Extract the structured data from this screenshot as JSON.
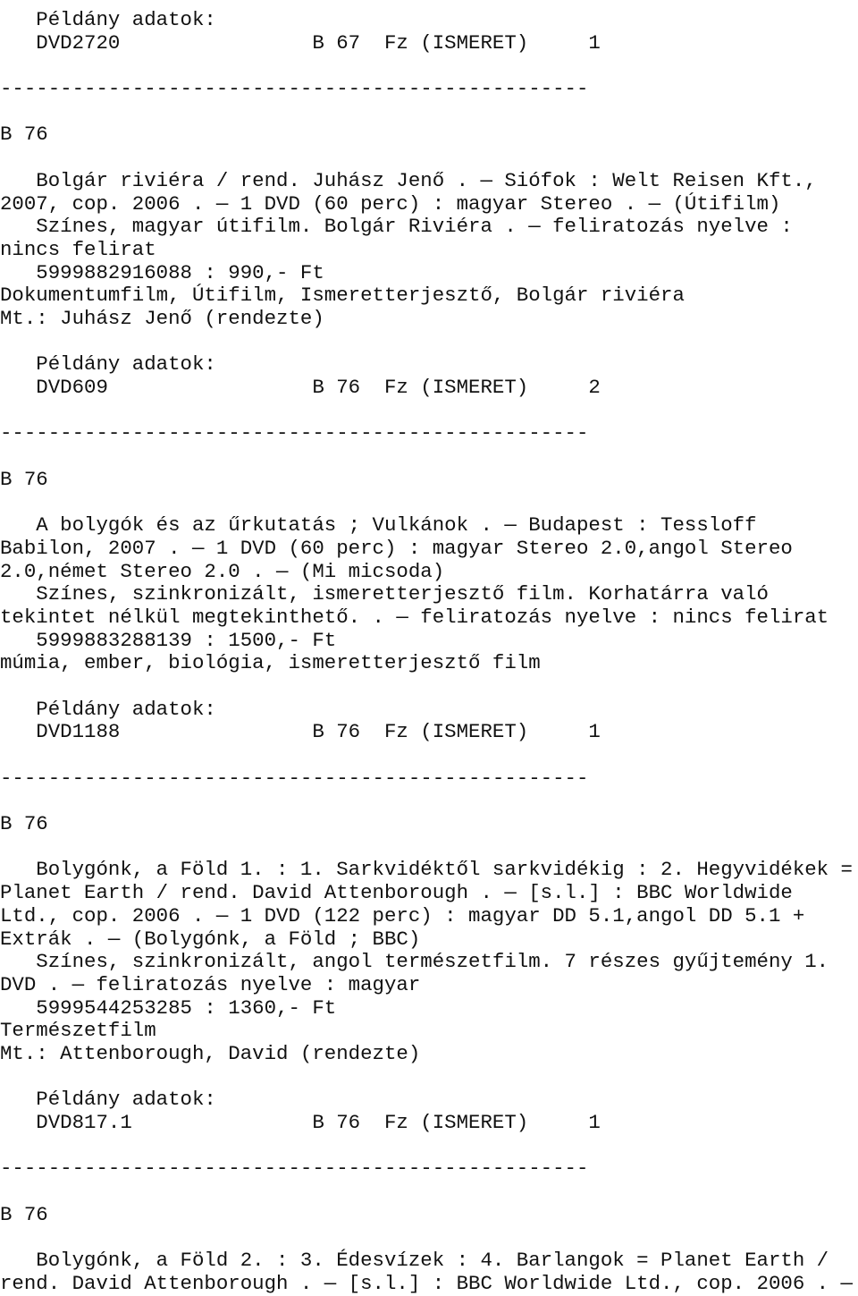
{
  "records": [
    {
      "copy_header": "   Példány adatok:",
      "copy_line": "   DVD2720                B 67  Fz (ISMERET)     1",
      "separator": "-------------------------------------------------",
      "shelfmark": "B 76",
      "description": [
        "   Bolgár riviéra / rend. Juhász Jenő . — Siófok : Welt Reisen Kft.,",
        "2007, cop. 2006 . — 1 DVD (60 perc) : magyar Stereo . — (Útifilm)",
        "   Színes, magyar útifilm. Bolgár Riviéra . — feliratozás nyelve :",
        "nincs felirat",
        "   5999882916088 : 990,- Ft",
        "Dokumentumfilm, Útifilm, Ismeretterjesztő, Bolgár riviéra",
        "Mt.: Juhász Jenő (rendezte)"
      ]
    },
    {
      "copy_header": "   Példány adatok:",
      "copy_line": "   DVD609                 B 76  Fz (ISMERET)     2",
      "separator": "-------------------------------------------------",
      "shelfmark": "B 76",
      "description": [
        "   A bolygók és az űrkutatás ; Vulkánok . — Budapest : Tessloff",
        "Babilon, 2007 . — 1 DVD (60 perc) : magyar Stereo 2.0,angol Stereo",
        "2.0,német Stereo 2.0 . — (Mi micsoda)",
        "   Színes, szinkronizált, ismeretterjesztő film. Korhatárra való",
        "tekintet nélkül megtekinthető. . — feliratozás nyelve : nincs felirat",
        "   5999883288139 : 1500,- Ft",
        "múmia, ember, biológia, ismeretterjesztő film"
      ]
    },
    {
      "copy_header": "   Példány adatok:",
      "copy_line": "   DVD1188                B 76  Fz (ISMERET)     1",
      "separator": "-------------------------------------------------",
      "shelfmark": "B 76",
      "description": [
        "   Bolygónk, a Föld 1. : 1. Sarkvidéktől sarkvidékig : 2. Hegyvidékek =",
        "Planet Earth / rend. David Attenborough . — [s.l.] : BBC Worldwide",
        "Ltd., cop. 2006 . — 1 DVD (122 perc) : magyar DD 5.1,angol DD 5.1 +",
        "Extrák . — (Bolygónk, a Föld ; BBC)",
        "   Színes, szinkronizált, angol természetfilm. 7 részes gyűjtemény 1.",
        "DVD . — feliratozás nyelve : magyar",
        "   5999544253285 : 1360,- Ft",
        "Természetfilm",
        "Mt.: Attenborough, David (rendezte)"
      ]
    },
    {
      "copy_header": "   Példány adatok:",
      "copy_line": "   DVD817.1               B 76  Fz (ISMERET)     1",
      "separator": "-------------------------------------------------",
      "shelfmark": "B 76",
      "description": [
        "   Bolygónk, a Föld 2. : 3. Édesvízek : 4. Barlangok = Planet Earth /",
        "rend. David Attenborough . — [s.l.] : BBC Worldwide Ltd., cop. 2006 . —"
      ]
    }
  ]
}
